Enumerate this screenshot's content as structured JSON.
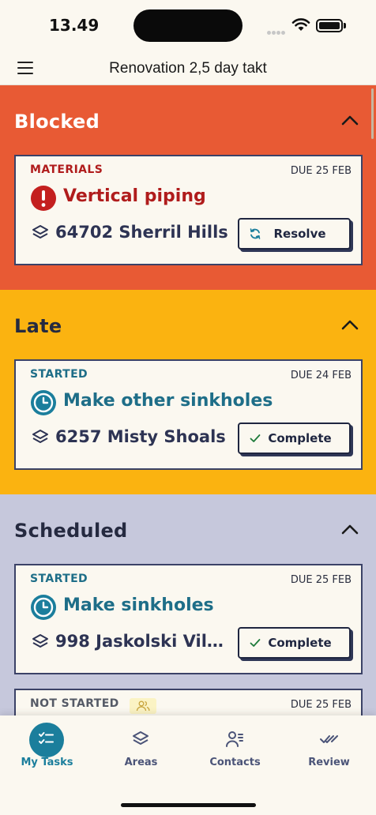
{
  "status_bar": {
    "time": "13.49"
  },
  "header": {
    "title": "Renovation 2,5 day takt"
  },
  "sections": {
    "blocked": {
      "title": "Blocked",
      "card": {
        "status": "MATERIALS",
        "due": "DUE 25 FEB",
        "title": "Vertical piping",
        "location": "64702 Sherril Hills",
        "action": "Resolve"
      }
    },
    "late": {
      "title": "Late",
      "card": {
        "status": "STARTED",
        "due": "DUE 24 FEB",
        "title": "Make other sinkholes",
        "location": "6257 Misty Shoals",
        "action": "Complete"
      }
    },
    "scheduled": {
      "title": "Scheduled",
      "cards": [
        {
          "status": "STARTED",
          "due": "DUE 25 FEB",
          "title": "Make sinkholes",
          "location": "998 Jaskolski Villa...",
          "action": "Complete"
        },
        {
          "status": "NOT STARTED",
          "due": "DUE 25 FEB"
        }
      ]
    }
  },
  "tabs": [
    {
      "label": "My Tasks",
      "icon": "tasks-icon",
      "active": true
    },
    {
      "label": "Areas",
      "icon": "layers-icon",
      "active": false
    },
    {
      "label": "Contacts",
      "icon": "contacts-icon",
      "active": false
    },
    {
      "label": "Review",
      "icon": "double-check-icon",
      "active": false
    }
  ],
  "colors": {
    "blocked": "#e85a34",
    "late": "#fbb310",
    "scheduled": "#c6c8dc",
    "accent": "#1b7e9c"
  }
}
